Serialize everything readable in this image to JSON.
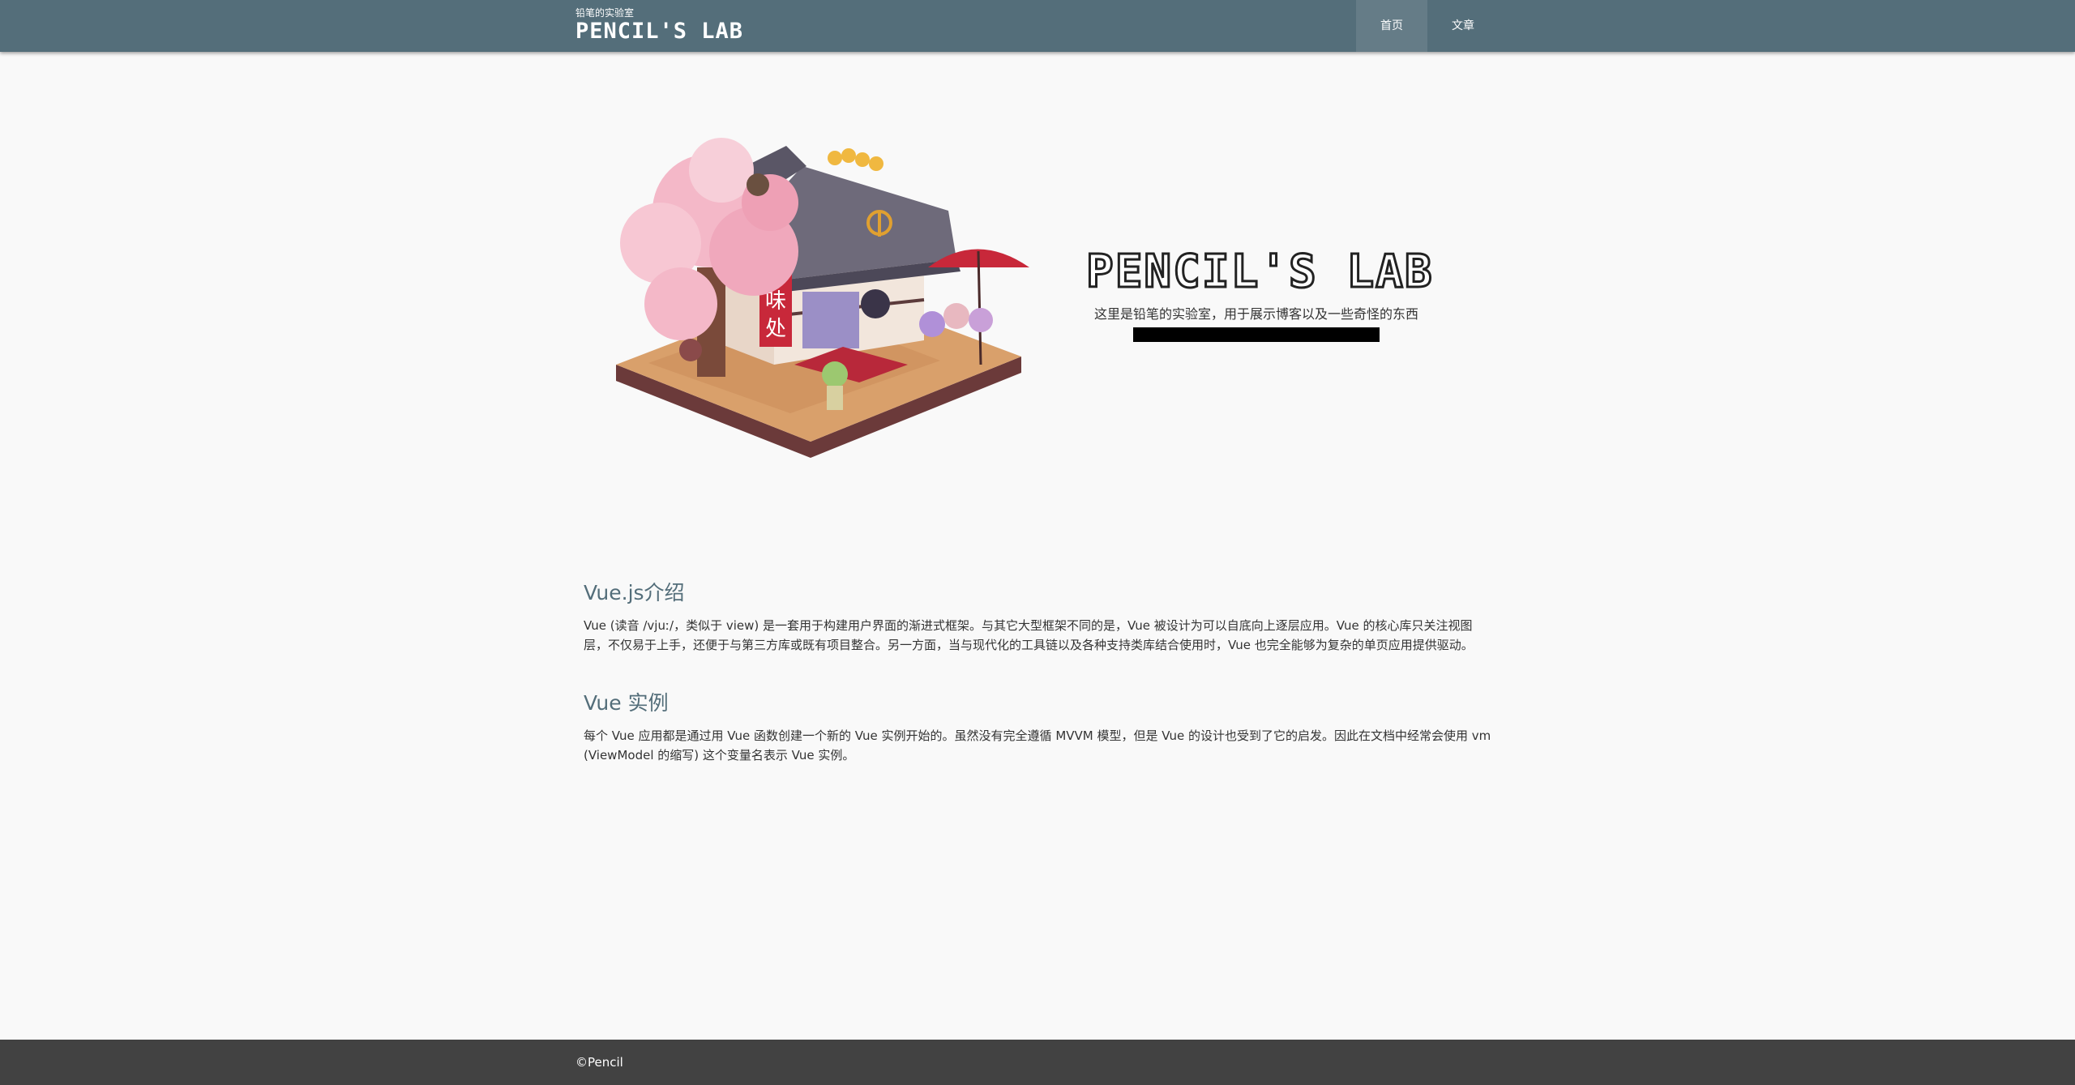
{
  "header": {
    "brand_subtitle": "铅笔的实验室",
    "brand_title": "PENCIL'S LAB",
    "nav": [
      {
        "label": "首页",
        "active": true
      },
      {
        "label": "文章",
        "active": false
      }
    ]
  },
  "hero": {
    "title": "PENCIL'S LAB",
    "description": "这里是铅笔的实验室，用于展示博客以及一些奇怪的东西",
    "sign_text": "甘味处"
  },
  "sections": [
    {
      "title": "Vue.js介绍",
      "body": "Vue (读音 /vjuː/，类似于 view) 是一套用于构建用户界面的渐进式框架。与其它大型框架不同的是，Vue 被设计为可以自底向上逐层应用。Vue 的核心库只关注视图层，不仅易于上手，还便于与第三方库或既有项目整合。另一方面，当与现代化的工具链以及各种支持类库结合使用时，Vue 也完全能够为复杂的单页应用提供驱动。"
    },
    {
      "title": "Vue 实例",
      "body": "每个 Vue 应用都是通过用 Vue 函数创建一个新的 Vue 实例开始的。虽然没有完全遵循 MVVM 模型，但是 Vue 的设计也受到了它的启发。因此在文档中经常会使用 vm (ViewModel 的缩写) 这个变量名表示 Vue 实例。"
    }
  ],
  "footer": {
    "copyright": "©Pencil"
  },
  "colors": {
    "header_bg": "#546e7a",
    "page_bg": "#f9f9f9",
    "heading": "#546e7a",
    "footer_bg": "#424242"
  }
}
